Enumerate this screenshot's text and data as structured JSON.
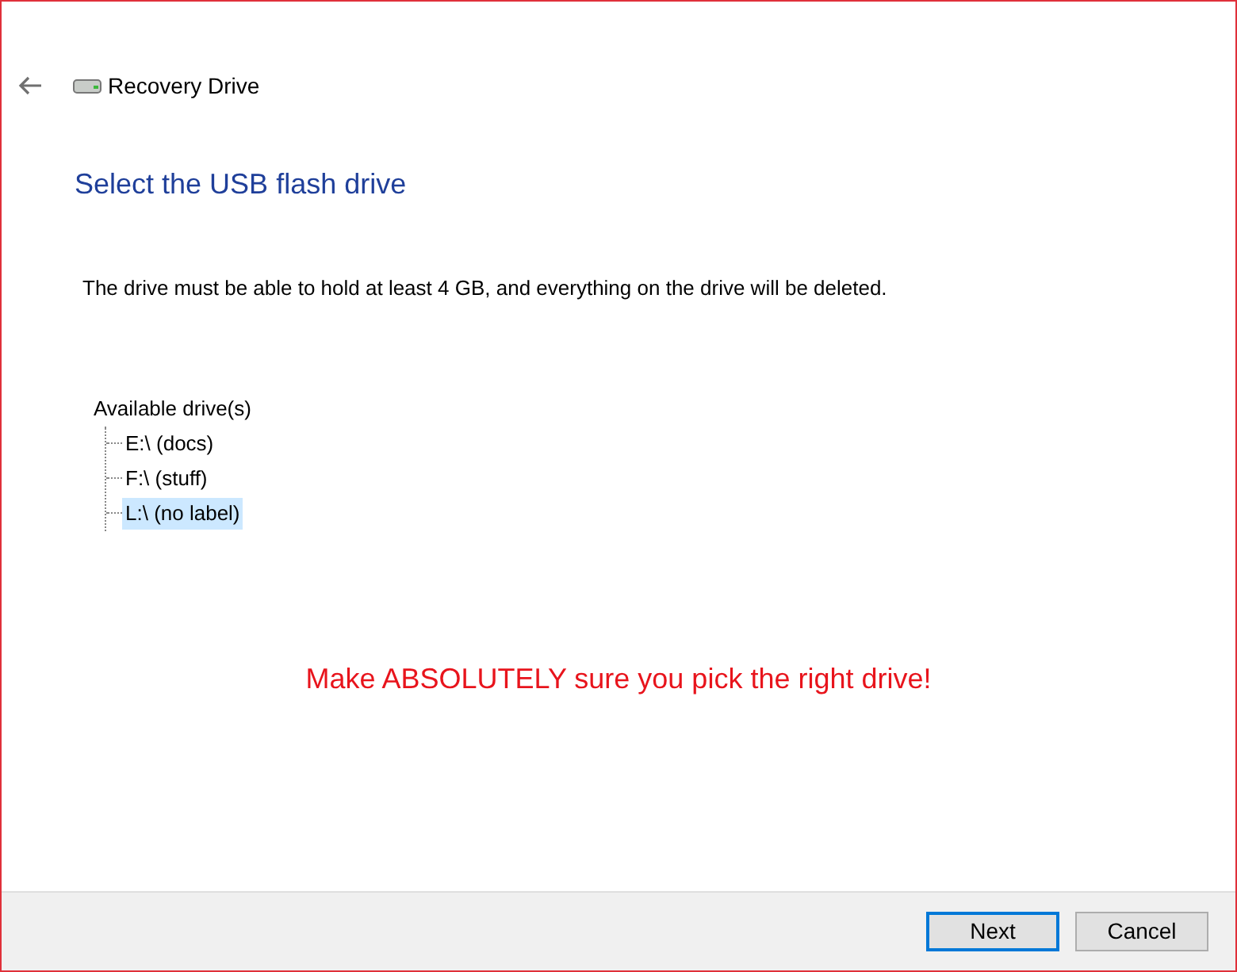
{
  "window": {
    "title": "Recovery Drive"
  },
  "heading": "Select the USB flash drive",
  "instruction": "The drive must be able to hold at least 4 GB, and everything on the drive will be deleted.",
  "tree": {
    "label": "Available drive(s)",
    "children": [
      {
        "label": "E:\\ (docs)",
        "selected": false
      },
      {
        "label": "F:\\ (stuff)",
        "selected": false
      },
      {
        "label": "L:\\ (no label)",
        "selected": true
      }
    ]
  },
  "annotation": "Make ABSOLUTELY sure you pick the right drive!",
  "buttons": [
    {
      "label": "Next",
      "default": true
    },
    {
      "label": "Cancel",
      "default": false
    }
  ]
}
